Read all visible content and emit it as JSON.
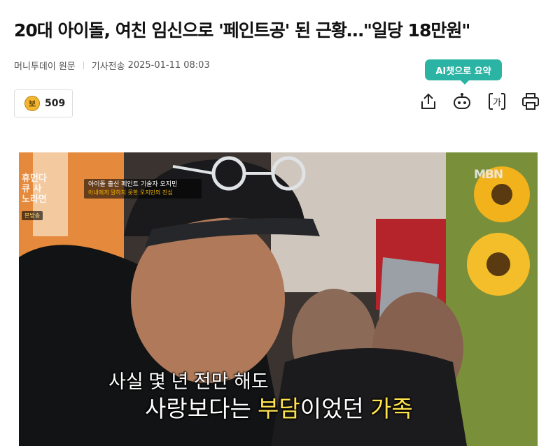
{
  "article": {
    "headline": "20대 아이돌, 여친 임신으로 '페인트공' 된 근황…\"일당 18만원\"",
    "source": "머니투데이",
    "source_link": "원문",
    "sent_label": "기사전송",
    "timestamp": "2025-01-11 08:03"
  },
  "toolbar": {
    "ai_summary_label": "AI챗으로 요약",
    "reaction_icon": "보",
    "reaction_count": "509",
    "translate_glyph": "가",
    "icons": [
      "share-icon",
      "chatbot-icon",
      "translate-icon",
      "print-icon"
    ]
  },
  "photo": {
    "caption_main": "아이돌 출신 페인트 기술자 오지민",
    "caption_sub": "아내에게 말하지 못한 오지민의 진심",
    "rerun_label": "본방송",
    "broadcaster": "MBN",
    "show_logo": "휴먼다큐 사노라면",
    "subtitle_line1": "사실 몇 년 전만 해도",
    "subtitle_line2_a": "사랑보다는 ",
    "subtitle_line2_b": "부담",
    "subtitle_line2_c": "이었던 ",
    "subtitle_line2_d": "가족"
  },
  "colors": {
    "accent_teal": "#2bb3a3",
    "coin_gold": "#f3b632",
    "subtitle_highlight": "#ffe34d"
  }
}
